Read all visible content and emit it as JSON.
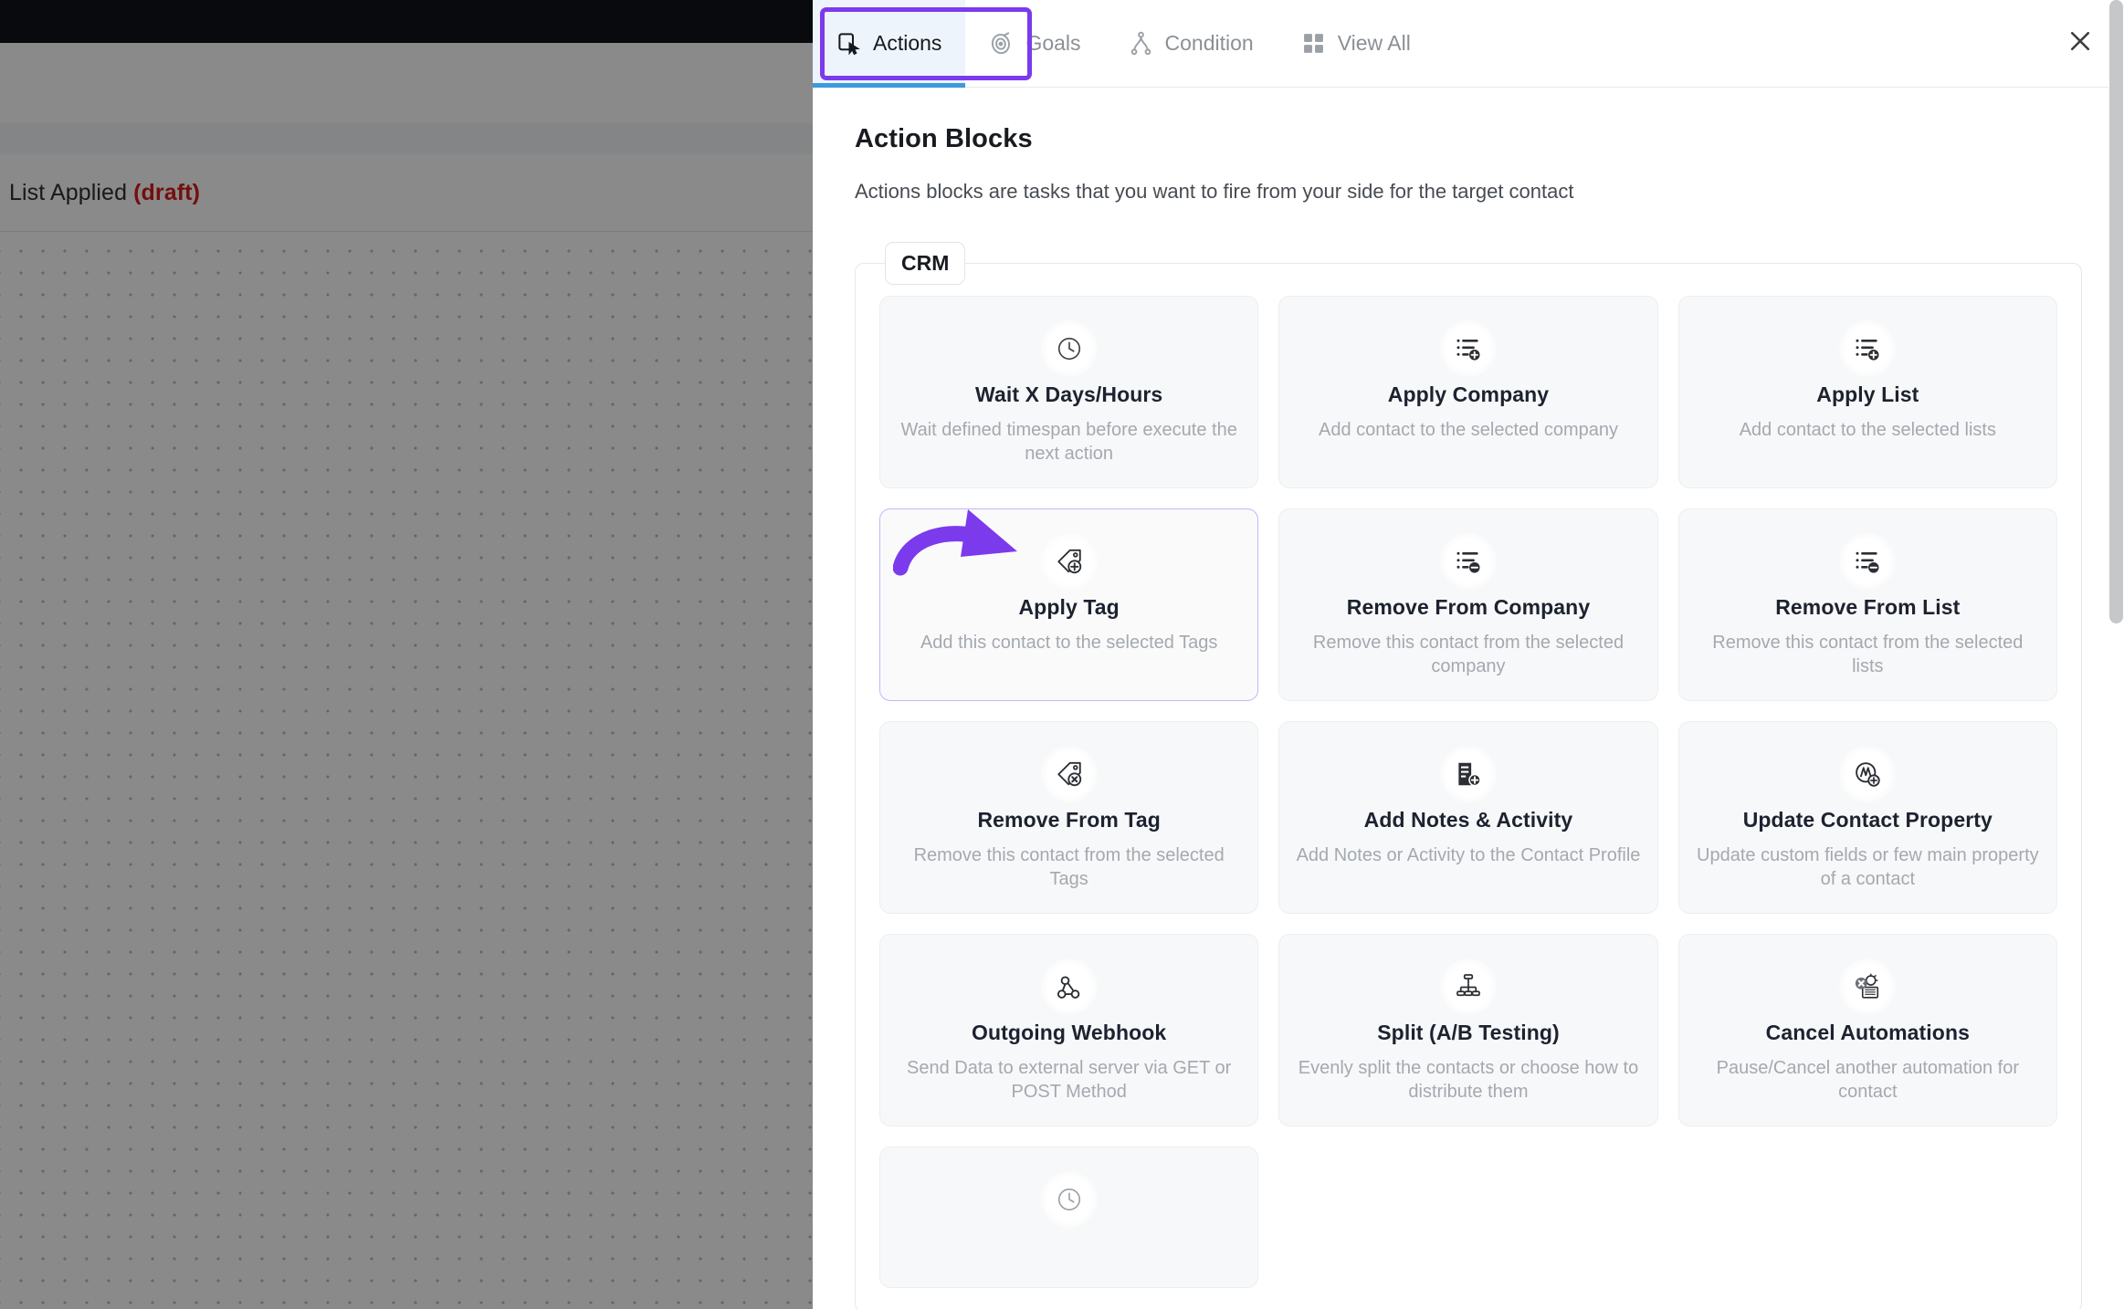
{
  "backdrop": {
    "title_text": "List Applied",
    "title_status": "(draft)"
  },
  "panel": {
    "tabs": [
      {
        "label": "Actions",
        "icon": "cursor-click-icon",
        "active": true
      },
      {
        "label": "Goals",
        "icon": "target-icon",
        "active": false
      },
      {
        "label": "Condition",
        "icon": "branch-icon",
        "active": false
      },
      {
        "label": "View All",
        "icon": "grid-icon",
        "active": false
      }
    ],
    "close_icon": "close-icon",
    "heading": "Action Blocks",
    "subheading": "Actions blocks are tasks that you want to fire from your side for the target contact",
    "group_label": "CRM",
    "accent_purple": "#7c3aed",
    "accent_blue": "#3c9ade",
    "cards": [
      {
        "title": "Wait X Days/Hours",
        "desc": "Wait defined timespan before execute the next action",
        "icon": "clock-icon",
        "selected": false
      },
      {
        "title": "Apply Company",
        "desc": "Add contact to the selected company",
        "icon": "list-plus-icon",
        "selected": false
      },
      {
        "title": "Apply List",
        "desc": "Add contact to the selected lists",
        "icon": "list-plus-icon",
        "selected": false
      },
      {
        "title": "Apply Tag",
        "desc": "Add this contact to the selected Tags",
        "icon": "tag-plus-icon",
        "selected": true
      },
      {
        "title": "Remove From Company",
        "desc": "Remove this contact from the selected company",
        "icon": "list-minus-icon",
        "selected": false
      },
      {
        "title": "Remove From List",
        "desc": "Remove this contact from the selected lists",
        "icon": "list-minus-icon",
        "selected": false
      },
      {
        "title": "Remove From Tag",
        "desc": "Remove this contact from the selected Tags",
        "icon": "tag-remove-icon",
        "selected": false
      },
      {
        "title": "Add Notes & Activity",
        "desc": "Add Notes or Activity to the Contact Profile",
        "icon": "note-plus-icon",
        "selected": false
      },
      {
        "title": "Update Contact Property",
        "desc": "Update custom fields or few main property of a contact",
        "icon": "user-edit-icon",
        "selected": false
      },
      {
        "title": "Outgoing Webhook",
        "desc": "Send Data to external server via GET or POST Method",
        "icon": "webhook-icon",
        "selected": false
      },
      {
        "title": "Split (A/B Testing)",
        "desc": "Evenly split the contacts or choose how to distribute them",
        "icon": "split-icon",
        "selected": false
      },
      {
        "title": "Cancel Automations",
        "desc": "Pause/Cancel another automation for contact",
        "icon": "cancel-automation-icon",
        "selected": false
      },
      {
        "title": "",
        "desc": "",
        "icon": "partial-icon",
        "selected": false,
        "partial": true
      }
    ]
  }
}
